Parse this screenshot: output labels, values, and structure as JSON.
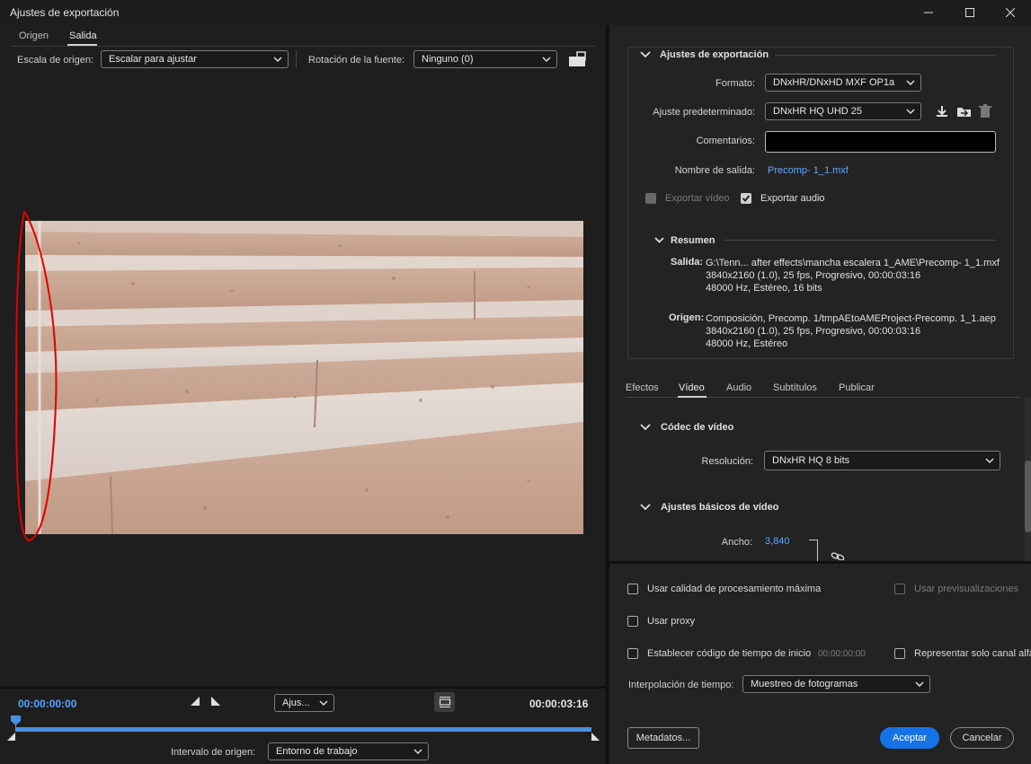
{
  "window": {
    "title": "Ajustes de exportación",
    "minimize_icon": "minimize-icon",
    "maximize_icon": "maximize-icon",
    "close_icon": "close-icon"
  },
  "left": {
    "tabs": [
      "Origen",
      "Salida"
    ],
    "active_tab": "Salida",
    "source_scale_label": "Escala de origen:",
    "source_scale_value": "Escalar para ajustar",
    "rotation_label": "Rotación de la fuente:",
    "rotation_value": "Ninguno (0)",
    "timecode_start": "00:00:00:00",
    "timecode_end": "00:00:03:16",
    "zoom_value": "Ajus...",
    "range_label": "Intervalo de origen:",
    "range_value": "Entorno de trabajo",
    "playhead_progress": 0.0
  },
  "export_settings": {
    "header": "Ajustes de exportación",
    "format_label": "Formato:",
    "format_value": "DNxHR/DNxHD MXF OP1a",
    "preset_label": "Ajuste predeterminado:",
    "preset_value": "DNxHR HQ UHD 25",
    "comments_label": "Comentarios:",
    "comments_value": "",
    "output_name_label": "Nombre de salida:",
    "output_name_value": "Precomp- 1_1.mxf",
    "export_video_label": "Exportar vídeo",
    "export_video_checked": true,
    "export_audio_label": "Exportar audio",
    "export_audio_checked": true,
    "summary_header": "Resumen",
    "output_label": "Salida:",
    "output_lines": [
      "G:\\Tenn... after effects\\mancha escalera 1_AME\\Precomp- 1_1.mxf",
      "3840x2160 (1.0), 25 fps, Progresivo, 00:00:03:16",
      "48000 Hz, Estéreo, 16 bits"
    ],
    "source_label": "Origen:",
    "source_lines": [
      "Composición, Precomp. 1/tmpAEtoAMEProject-Precomp. 1_1.aep",
      "3840x2160 (1.0), 25 fps, Progresivo, 00:00:03:16",
      "48000 Hz, Estéreo"
    ]
  },
  "tabs2": {
    "items": [
      "Efectos",
      "Vídeo",
      "Audio",
      "Subtítulos",
      "Publicar"
    ],
    "active": "Vídeo"
  },
  "video": {
    "codec_header": "Códec de vídeo",
    "resolution_label": "Resolución:",
    "resolution_value": "DNxHR HQ 8 bits",
    "basic_header": "Ajustes básicos de vídeo",
    "width_label": "Ancho:",
    "width_value": "3,840"
  },
  "options": {
    "max_quality_label": "Usar calidad de procesamiento máxima",
    "use_previews_label": "Usar previsualizaciones",
    "use_proxy_label": "Usar proxy",
    "set_timecode_label": "Establecer código de tiempo de inicio",
    "set_timecode_value": "00:00:00:00",
    "alpha_only_label": "Representar solo canal alfa",
    "time_interp_label": "Interpolación de tiempo:",
    "time_interp_value": "Muestreo de fotogramas"
  },
  "footer": {
    "metadata_label": "Metadatos...",
    "accept_label": "Aceptar",
    "cancel_label": "Cancelar"
  },
  "colors": {
    "accent": "#1473e6",
    "link": "#62a7ff",
    "timeline": "#4a90e2",
    "annotation": "#e00000"
  }
}
